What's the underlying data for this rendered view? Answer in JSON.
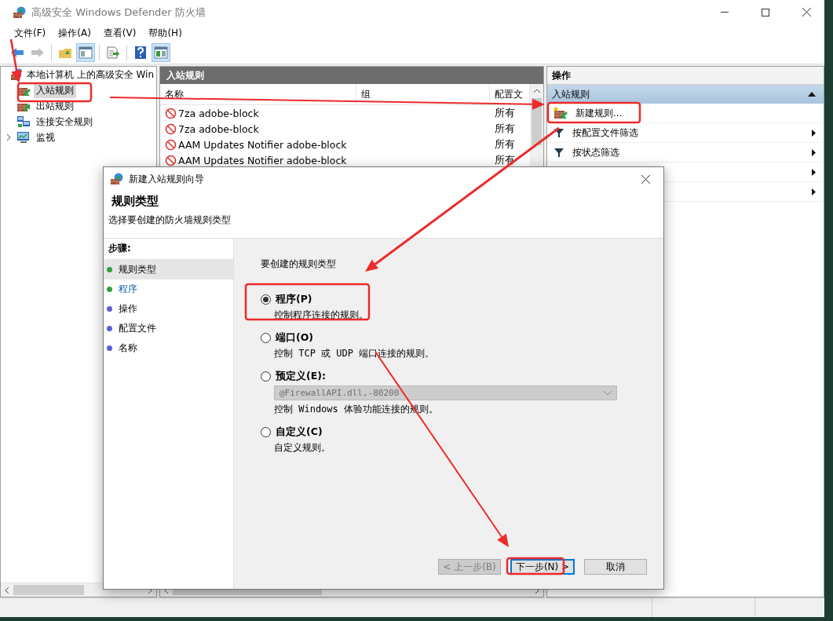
{
  "window": {
    "title": "高级安全 Windows Defender 防火墙"
  },
  "menu": [
    "文件(F)",
    "操作(A)",
    "查看(V)",
    "帮助(H)"
  ],
  "toolbar": [
    {
      "kind": "back",
      "disabled": false,
      "pressed": false
    },
    {
      "kind": "forward",
      "disabled": true,
      "pressed": false
    },
    {
      "kind": "up",
      "disabled": false,
      "pressed": false
    },
    {
      "kind": "tree",
      "disabled": false,
      "pressed": true
    },
    {
      "kind": "export",
      "disabled": false,
      "pressed": false
    },
    {
      "kind": "help",
      "disabled": false,
      "pressed": false
    },
    {
      "kind": "actions",
      "disabled": false,
      "pressed": true
    }
  ],
  "tree": {
    "label": "本地计算机 上的高级安全 Win",
    "children": [
      {
        "label": "入站规则",
        "kind": "inbound",
        "selected": true
      },
      {
        "label": "出站规则",
        "kind": "outbound",
        "selected": false
      },
      {
        "label": "连接安全规则",
        "kind": "connection",
        "selected": false
      },
      {
        "label": "监视",
        "kind": "monitor",
        "selected": false,
        "expanded": false
      }
    ]
  },
  "list": {
    "title": "入站规则",
    "columns": [
      "名称",
      "组",
      "配置文"
    ],
    "rows": [
      {
        "name": "7za adobe-block",
        "profile": "所有"
      },
      {
        "name": "7za adobe-block",
        "profile": "所有"
      },
      {
        "name": "AAM Updates Notifier adobe-block",
        "profile": "所有"
      },
      {
        "name": "AAM Updates Notifier adobe-block",
        "profile": "所有"
      }
    ]
  },
  "actions": {
    "title": "操作",
    "section": {
      "label": "入站规则",
      "expanded": true
    },
    "items": [
      {
        "kind": "new",
        "label": "新建规则...",
        "submenu": false
      },
      {
        "kind": "filter",
        "label": "按配置文件筛选",
        "submenu": true
      },
      {
        "kind": "filter",
        "label": "按状态筛选",
        "submenu": true
      },
      {
        "kind": "covered",
        "submenu": true
      },
      {
        "kind": "covered",
        "submenu": true
      }
    ]
  },
  "dialog": {
    "title": "新建入站规则向导",
    "heading": "规则类型",
    "subtitle": "选择要创建的防火墙规则类型",
    "steps_title": "步骤:",
    "steps": [
      {
        "label": "规则类型",
        "selected": true,
        "reached": true
      },
      {
        "label": "程序",
        "selected": false,
        "reached": true
      },
      {
        "label": "操作",
        "selected": false,
        "reached": false
      },
      {
        "label": "配置文件",
        "selected": false,
        "reached": false
      },
      {
        "label": "名称",
        "selected": false,
        "reached": false
      }
    ],
    "prompt": "要创建的规则类型",
    "options": [
      {
        "label": "程序(P)",
        "description": "控制程序连接的规则。",
        "selected": true
      },
      {
        "label": "端口(O)",
        "description": "控制 TCP 或 UDP 端口连接的规则。",
        "selected": false
      },
      {
        "label": "预定义(E):",
        "dropdown": {
          "value": "@FirewallAPI.dll,-80200",
          "disabled": true
        },
        "description": "控制 Windows 体验功能连接的规则。",
        "selected": false
      },
      {
        "label": "自定义(C)",
        "description": "自定义规则。",
        "selected": false
      }
    ],
    "buttons": [
      {
        "label": "< 上一步(B)",
        "disabled": true,
        "default": false
      },
      {
        "label": "下一步(N) >",
        "disabled": false,
        "default": true
      },
      {
        "label": "取消",
        "disabled": false,
        "default": false
      }
    ]
  }
}
